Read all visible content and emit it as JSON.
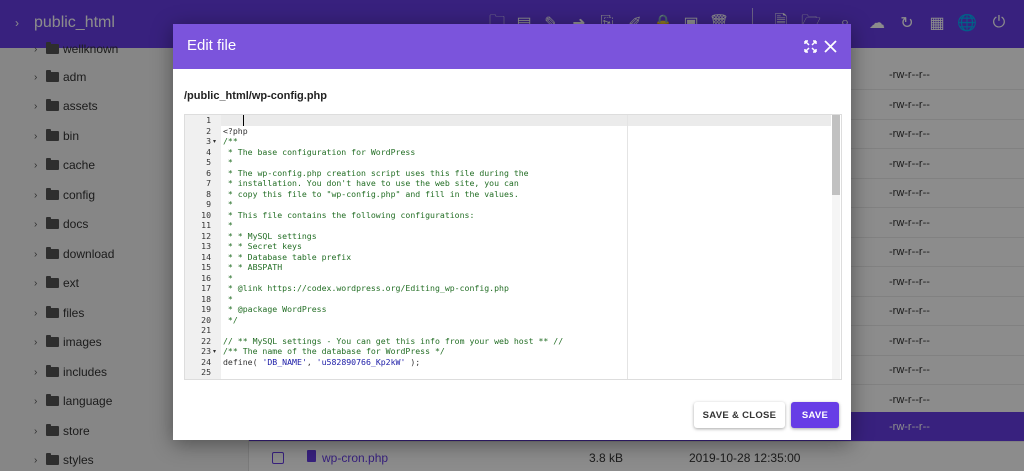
{
  "topbar": {
    "path": "public_html"
  },
  "sidebar": {
    "folders": [
      "wellknown",
      "adm",
      "assets",
      "bin",
      "cache",
      "config",
      "docs",
      "download",
      "ext",
      "files",
      "images",
      "includes",
      "language",
      "store",
      "styles"
    ]
  },
  "file_list": {
    "permissions": [
      "-rw-r--r--",
      "-rw-r--r--",
      "-rw-r--r--",
      "-rw-r--r--",
      "-rw-r--r--",
      "-rw-r--r--",
      "-rw-r--r--",
      "-rw-r--r--",
      "-rw-r--r--",
      "-rw-r--r--",
      "-rw-r--r--",
      "-rw-r--r--",
      "-rw-r--r--"
    ],
    "selected_perm": "-rw-r--r--",
    "last_file": {
      "name": "wp-cron.php",
      "size": "3.8 kB",
      "modified": "2019-10-28 12:35:00"
    }
  },
  "modal": {
    "title": "Edit file",
    "file_path": "/public_html/wp-config.php",
    "save_close_label": "SAVE & CLOSE",
    "save_label": "SAVE"
  },
  "editor": {
    "lines": [
      "",
      "<?php",
      "/**",
      " * The base configuration for WordPress",
      " *",
      " * The wp-config.php creation script uses this file during the",
      " * installation. You don't have to use the web site, you can",
      " * copy this file to \"wp-config.php\" and fill in the values.",
      " *",
      " * This file contains the following configurations:",
      " *",
      " * * MySQL settings",
      " * * Secret keys",
      " * * Database table prefix",
      " * * ABSPATH",
      " *",
      " * @link https://codex.wordpress.org/Editing_wp-config.php",
      " *",
      " * @package WordPress",
      " */",
      "",
      "// ** MySQL settings - You can get this info from your web host ** //",
      "/** The name of the database for WordPress */",
      "define( 'DB_NAME', 'u582890766_Kp2kW' );",
      ""
    ]
  }
}
